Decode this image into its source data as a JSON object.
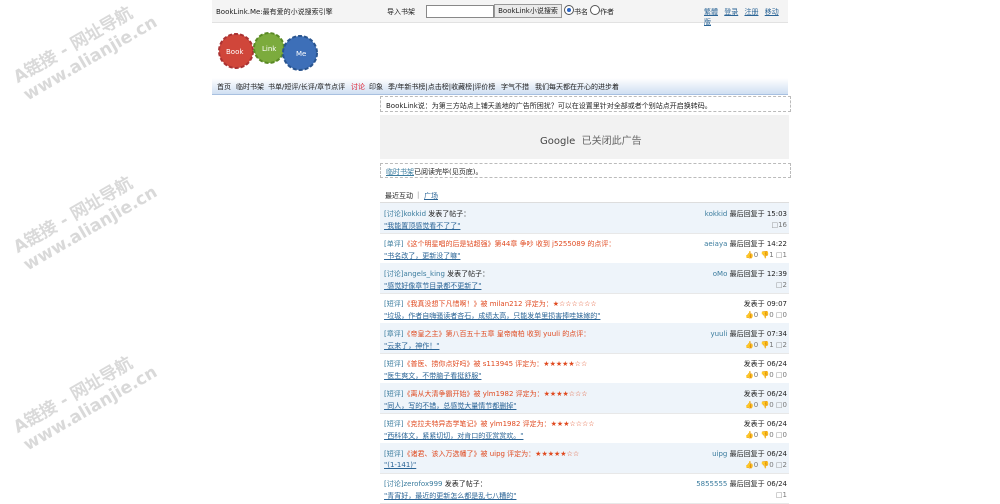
{
  "topbar": {
    "slogan": "BookLink.Me:最有爱的小说搜索引擎",
    "import_label": "导入书架",
    "search_placeholder": "",
    "search_button": "BookLink小说搜索",
    "radio_bookname": "书名",
    "radio_author": "作者",
    "links": [
      "繁體",
      "登录",
      "注册",
      "移动版"
    ]
  },
  "logo": {
    "letters": [
      "Book",
      "Link",
      "Me"
    ]
  },
  "nav": {
    "items": [
      "首页",
      "临时书架",
      "书单/短评/长评/章节点评",
      "讨论",
      "印象",
      "季/年新书榜|点击榜|收藏榜|评价榜",
      "字气不措",
      "我们每天都在开心的进步着"
    ]
  },
  "notice": "BookLink说：为第三方站点上铺天盖地的广告所困扰？可以在设置里针对全部或者个别站点开启换转码。",
  "ad": {
    "google": "Google",
    "closed": "已关闭此广告"
  },
  "done": {
    "link": "临时书架",
    "text": "已阅读完毕(见页底)。"
  },
  "tabs": {
    "recent": "最近互动",
    "sep": "|",
    "square": "广场"
  },
  "feed": [
    {
      "tag": "[讨论]",
      "user": "kokkid",
      "action": " 发表了帖子：",
      "extra": "",
      "quote": "\"我能置顶感觉看不了了\"",
      "right_user": "kokkid",
      "right_text": " 最后回复于 15:03",
      "up": "",
      "down": "",
      "comments": "16"
    },
    {
      "tag": "[单评]",
      "user": "",
      "action": "",
      "extra": "《这个明星唱的后是钻超强》第44章 争吵 收到 j5255089 的点评：",
      "quote": "\"书名改了，更新没了嘛\"",
      "right_user": "aeiaya",
      "right_text": " 最后回复于 14:22",
      "up": "0",
      "down": "1",
      "comments": "1"
    },
    {
      "tag": "[讨论]",
      "user": "angels_king",
      "action": " 发表了帖子：",
      "extra": "",
      "quote": "\"感觉好像章节目录都不更新了\"",
      "right_user": "oMo",
      "right_text": " 最后回复于 12:39",
      "up": "",
      "down": "",
      "comments": "2"
    },
    {
      "tag": "[短评]",
      "user": "",
      "action": "",
      "extra": "《我真没想下凡惜啊！》被 milan212 评定为：★☆☆☆☆☆☆",
      "quote": "\"垃圾，作者自嗨骚读者吝石，成绩太高，只能发单里损害捧哇妹嫁的\"",
      "right_user": "",
      "right_text": "发表于 09:07",
      "up": "0",
      "down": "0",
      "comments": "0"
    },
    {
      "tag": "[章评]",
      "user": "",
      "action": "",
      "extra": "《帝皇之主》第八百五十五章 皇帝南柏 收到 yuuli 的点评：",
      "quote": "\"云来了，神作！\"",
      "right_user": "yuuli",
      "right_text": " 最后回复于 07:34",
      "up": "0",
      "down": "1",
      "comments": "2"
    },
    {
      "tag": "[短评]",
      "user": "",
      "action": "",
      "extra": "《普医、捞你点好吗》被 s113945 评定为：★★★★★☆☆",
      "quote": "\"医生爽文，不带脑子看挺舒服\"",
      "right_user": "",
      "right_text": "发表于 06/24",
      "up": "0",
      "down": "0",
      "comments": "0"
    },
    {
      "tag": "[短评]",
      "user": "",
      "action": "",
      "extra": "《离从大清争霸开始》被 ylm1982 评定为：★★★★☆☆☆",
      "quote": "\"同人，写的不错，总感觉大量情节都删掉\"",
      "right_user": "",
      "right_text": "发表于 06/24",
      "up": "0",
      "down": "0",
      "comments": "0"
    },
    {
      "tag": "[短评]",
      "user": "",
      "action": "",
      "extra": "《克拉夫特异态学笔记》被 ylm1982 评定为：★★★☆☆☆☆",
      "quote": "\"西科体文，紧紧切切，对肯口的亚赏赏欢。\"",
      "right_user": "",
      "right_text": "发表于 06/24",
      "up": "0",
      "down": "0",
      "comments": "0"
    },
    {
      "tag": "[短评]",
      "user": "",
      "action": "",
      "extra": "《诸君、该入万选幡了》被 uipg 评定为：★★★★★☆☆",
      "quote": "\"(1-141)\"",
      "right_user": "uipg",
      "right_text": " 最后回复于 06/24",
      "up": "0",
      "down": "0",
      "comments": "2"
    },
    {
      "tag": "[讨论]",
      "user": "zerofox999",
      "action": " 发表了帖子：",
      "extra": "",
      "quote": "\"青宵好，最近的更新怎么都是乱七八糟的\"",
      "right_user": "5855555",
      "right_text": " 最后回复于 06/24",
      "up": "",
      "down": "",
      "comments": "1"
    }
  ],
  "watermark": {
    "line1": "A链接 - 网址导航",
    "line2": "www.alianjie.cn"
  }
}
